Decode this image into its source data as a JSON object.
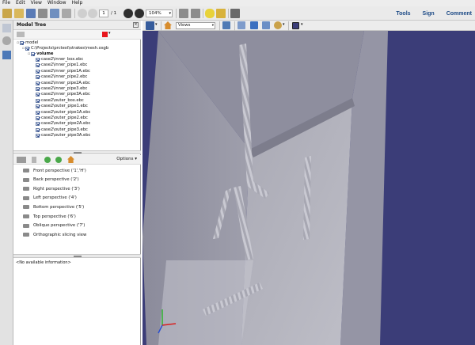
{
  "menu": [
    "File",
    "Edit",
    "View",
    "Window",
    "Help"
  ],
  "toolbar": {
    "page_current": "1",
    "page_total": "/ 1",
    "zoom": "104%",
    "links": [
      "Tools",
      "Sign",
      "Comment"
    ]
  },
  "panel": {
    "title": "Model Tree",
    "accent_color": "#e8141b",
    "tree": {
      "root": "model",
      "file": "C:\\Projects\\prctest\\strakes\\mesh.osgb",
      "group": "volume",
      "items": [
        "case2\\inner_box.ebc",
        "case2\\inner_pipe1.ebc",
        "case2\\inner_pipe1A.ebc",
        "case2\\inner_pipe2.ebc",
        "case2\\inner_pipe2A.ebc",
        "case2\\inner_pipe3.ebc",
        "case2\\inner_pipe3A.ebc",
        "case2\\outer_box.ebc",
        "case2\\outer_pipe1.ebc",
        "case2\\outer_pipe1A.ebc",
        "case2\\outer_pipe2.ebc",
        "case2\\outer_pipe2A.ebc",
        "case2\\outer_pipe3.ebc",
        "case2\\outer_pipe3A.ebc"
      ]
    },
    "views_options": "Options",
    "views": [
      "Front perspective ('1','H')",
      "Back perspective ('2')",
      "Right perspective ('3')",
      "Left perspective ('4')",
      "Bottom perspective ('5')",
      "Top perspective ('6')",
      "Oblique perspective ('7')",
      "Orthographic slicing view"
    ],
    "info": "<No available information>"
  },
  "toolbar3d": {
    "views_select": "Views",
    "background_color": "#3b3d78"
  }
}
